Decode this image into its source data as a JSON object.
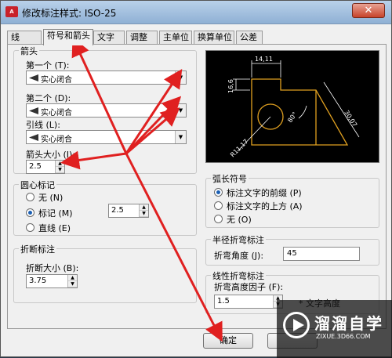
{
  "window": {
    "title": "修改标注样式: ISO-25",
    "close_label": "✕"
  },
  "tabs": [
    "线",
    "符号和箭头",
    "文字",
    "调整",
    "主单位",
    "换算单位",
    "公差"
  ],
  "arrowheads": {
    "title": "箭头",
    "first_label": "第一个 (T):",
    "first_value": "实心闭合",
    "second_label": "第二个 (D):",
    "second_value": "实心闭合",
    "leader_label": "引线 (L):",
    "leader_value": "实心闭合",
    "size_label": "箭头大小 (I):",
    "size_value": "2.5"
  },
  "center_marks": {
    "title": "圆心标记",
    "options": [
      "无 (N)",
      "标记 (M)",
      "直线 (E)"
    ],
    "selected": "标记 (M)",
    "value": "2.5"
  },
  "dim_break": {
    "title": "折断标注",
    "size_label": "折断大小 (B):",
    "size_value": "3.75"
  },
  "arc_length": {
    "title": "弧长符号",
    "options": [
      "标注文字的前缀 (P)",
      "标注文字的上方 (A)",
      "无 (O)"
    ],
    "selected": "标注文字的前缀 (P)"
  },
  "radius_jog": {
    "title": "半径折弯标注",
    "angle_label": "折弯角度 (J):",
    "angle_value": "45"
  },
  "linear_jog": {
    "title": "线性折弯标注",
    "height_label": "折弯高度因子 (F):",
    "height_value": "1.5",
    "unit_label": "* 文字高度"
  },
  "preview": {
    "dim_top": "14,11",
    "dim_left": "16,6",
    "dim_right": "30,07",
    "dim_angle": "80°",
    "dim_radius": "R11,17"
  },
  "buttons": {
    "ok": "确定",
    "cancel": ""
  },
  "watermark": {
    "title": "溜溜自学",
    "subtitle": "ZIXUE.3D66.COM"
  },
  "colors": {
    "annotation_arrow": "#e02020",
    "preview_geometry": "#e0a020",
    "preview_dim": "#ffffff"
  }
}
